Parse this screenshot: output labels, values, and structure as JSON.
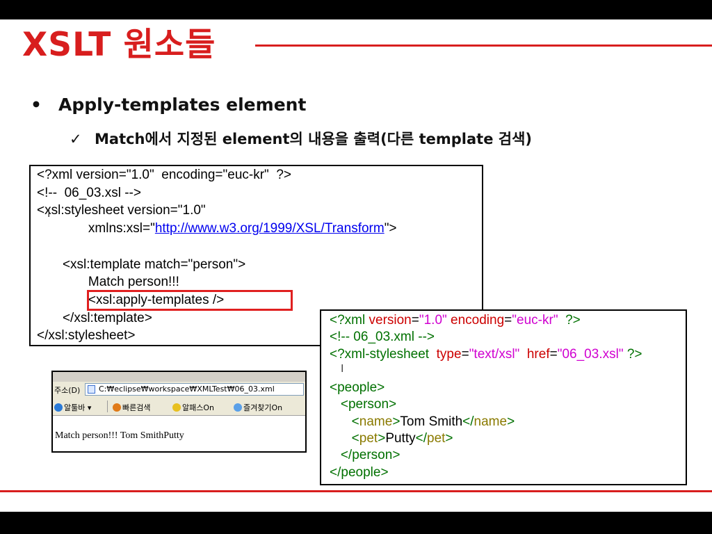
{
  "slide": {
    "title": "XSLT 원소들",
    "bullet_level1": "Apply-templates element",
    "bullet_level2": "Match에서 지정된 element의 내용을 출력(다른 template 검색)",
    "bullet_marker": "•",
    "check_marker": "✓"
  },
  "xsl_code": {
    "line1": "<?xml version=\"1.0\"  encoding=\"euc-kr\"  ?>",
    "line2": "<!--  06_03.xsl -->",
    "line3": "<xsl:stylesheet version=\"1.0\"",
    "line4_prefix": "              xmlns:xsl=\"",
    "line4_link": "http://www.w3.org/1999/XSL/Transform",
    "line4_suffix": "\">",
    "line5": "",
    "line6": "       <xsl:template match=\"person\">",
    "line7": "              Match person!!!",
    "line8": "              <xsl:apply-templates />",
    "line9": "       </xsl:template>",
    "line10": "</xsl:stylesheet>"
  },
  "xml_code": {
    "l1": {
      "a": "<?xml ",
      "b": "version",
      "c": "=",
      "d": "\"1.0\"",
      "e": " encoding",
      "f": "=",
      "g": "\"euc-kr\"",
      "h": "  ?>"
    },
    "l2": "<!-- 06_03.xml -->",
    "l3": {
      "a": "<?xml-stylesheet  ",
      "b": "type",
      "c": "=",
      "d": "\"text/xsl\"",
      "e": "  href",
      "f": "=",
      "g": "\"06_03.xsl\"",
      "h": " ?>"
    },
    "l4_open": "<",
    "l4_tag": "people",
    "l4_close": ">",
    "l5_open": "   <",
    "l5_tag": "person",
    "l5_close": ">",
    "l6": {
      "o1": "      <",
      "t1": "name",
      "c1": ">",
      "text": "Tom Smith",
      "o2": "</",
      "t2": "name",
      "c2": ">"
    },
    "l7": {
      "o1": "      <",
      "t1": "pet",
      "c1": ">",
      "text": "Putty",
      "o2": "</",
      "t2": "pet",
      "c2": ">"
    },
    "l8_open": "   </",
    "l8_tag": "person",
    "l8_close": ">",
    "l9_open": "</",
    "l9_tag": "people",
    "l9_close": ">"
  },
  "browser": {
    "address_label": "주소(D)",
    "address_url": "C:₩eclipse₩workspace₩XMLTest₩06_03.xml",
    "links": [
      "알툴바 ▾",
      "빠른검색",
      "알패스On",
      "즐겨찾기On"
    ],
    "content": "Match person!!! Tom SmithPutty"
  },
  "colors": {
    "accent_red": "#d81e1e",
    "xml_tag_green": "#007000",
    "xml_attr_red": "#cc0000",
    "xml_value_magenta": "#d000d0",
    "xml_tagname_olive": "#8a7a00",
    "link_blue": "#0000ee"
  }
}
